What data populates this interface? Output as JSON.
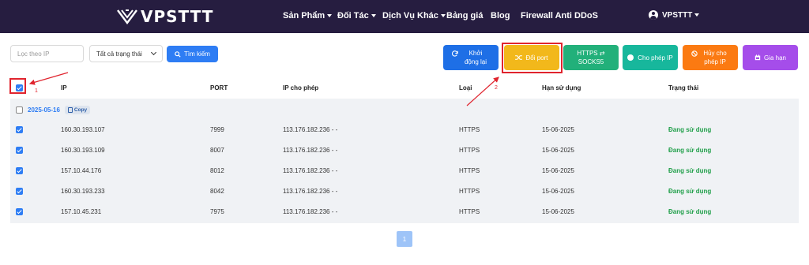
{
  "navbar": {
    "brand": "VPSTTT",
    "items": [
      {
        "label": "Sản Phẩm",
        "dropdown": true
      },
      {
        "label": "Đối Tác",
        "dropdown": true
      },
      {
        "label": "Dịch Vụ Khác",
        "dropdown": true
      },
      {
        "label": "Bảng giá",
        "dropdown": false
      },
      {
        "label": "Blog",
        "dropdown": false
      },
      {
        "label": "Firewall Anti DDoS",
        "dropdown": false
      }
    ],
    "user": "VPSTTT"
  },
  "filters": {
    "ip_placeholder": "Lọc theo IP",
    "status_selected": "Tất cả trạng thái",
    "search_label": "Tìm kiếm"
  },
  "actions": {
    "restart": "Khởi động lại",
    "change_port": "Đổi port",
    "https_socks": "HTTPS ⇄ SOCKS5",
    "allow_ip": "Cho phép IP",
    "cancel_allow_ip": "Hủy cho phép IP",
    "renew": "Gia hạn"
  },
  "table": {
    "headers": {
      "ip": "IP",
      "port": "PORT",
      "allowed_ip": "IP cho phép",
      "type": "Loại",
      "expiry": "Hạn sử dụng",
      "status": "Trạng thái"
    },
    "group": {
      "date": "2025-05-16",
      "copy_label": "Copy"
    },
    "rows": [
      {
        "ip": "160.30.193.107",
        "port": "7999",
        "allowed_ip": "113.176.182.236 - -",
        "type": "HTTPS",
        "expiry": "15-06-2025",
        "status": "Đang sử dụng"
      },
      {
        "ip": "160.30.193.109",
        "port": "8007",
        "allowed_ip": "113.176.182.236 - -",
        "type": "HTTPS",
        "expiry": "15-06-2025",
        "status": "Đang sử dụng"
      },
      {
        "ip": "157.10.44.176",
        "port": "8012",
        "allowed_ip": "113.176.182.236 - -",
        "type": "HTTPS",
        "expiry": "15-06-2025",
        "status": "Đang sử dụng"
      },
      {
        "ip": "160.30.193.233",
        "port": "8042",
        "allowed_ip": "113.176.182.236 - -",
        "type": "HTTPS",
        "expiry": "15-06-2025",
        "status": "Đang sử dụng"
      },
      {
        "ip": "157.10.45.231",
        "port": "7975",
        "allowed_ip": "113.176.182.236 - -",
        "type": "HTTPS",
        "expiry": "15-06-2025",
        "status": "Đang sử dụng"
      }
    ]
  },
  "pagination": {
    "current": "1"
  },
  "annotations": {
    "step1": "1",
    "step2": "2"
  },
  "colors": {
    "navbar": "#261d40",
    "primary": "#2e7df4",
    "highlight": "#e0242e",
    "status_active": "#22a04b"
  }
}
